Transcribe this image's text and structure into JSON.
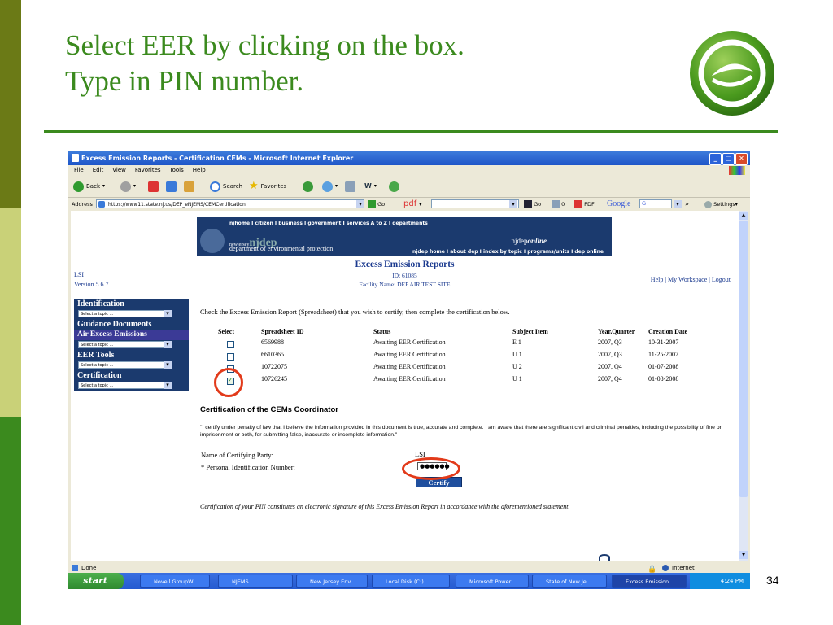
{
  "slide": {
    "title_line1": "Select EER by clicking on the box.",
    "title_line2": "Type in PIN number.",
    "page_number": "34",
    "colors": {
      "title": "#3b8a1e",
      "stripe_dark": "#6b7a16",
      "stripe_light": "#c9d178",
      "stripe_green": "#3b8a1e"
    }
  },
  "browser": {
    "title": "Excess Emission Reports - Certification CEMs - Microsoft Internet Explorer",
    "menu": [
      "File",
      "Edit",
      "View",
      "Favorites",
      "Tools",
      "Help"
    ],
    "toolbar": {
      "back": "Back",
      "search": "Search",
      "favorites": "Favorites",
      "go": "Go",
      "pdf": "pdf",
      "go2": "Go",
      "counter": "0",
      "pdf2": "PDF",
      "google": "Google",
      "g": "G",
      "settings": "Settings"
    },
    "address_label": "Address",
    "address": "https://www11.state.nj.us/DEP_eNJEMS/CEMCertification",
    "status": "Done",
    "zone": "Internet"
  },
  "taskbar": {
    "start": "start",
    "items": [
      "Novell GroupWi...",
      "NJEMS",
      "New Jersey Env...",
      "Local Disk (C:)",
      "Microsoft Power...",
      "State of New Je...",
      "Excess Emission..."
    ],
    "clock": "4:24 PM"
  },
  "page": {
    "banner": {
      "top_links": "njhome  I  citizen  I  business  I  government  I  services A to Z  I  departments",
      "newjersey": "newjersey",
      "njdep": "njdep",
      "dept": "department of environmental protection",
      "online_prefix": "njdep",
      "online": "online",
      "sub_links": "njdep home  I  about dep  I  index by topic  I  programs/units  I  dep online"
    },
    "report_title": "Excess Emission Reports",
    "id_line": "ID: 61085",
    "facility_line": "Facility Name: DEP AIR TEST SITE",
    "lsi": "LSI",
    "version": "Version 5.6.7",
    "links": {
      "help": "Help",
      "workspace": "My Workspace",
      "logout": "Logout",
      "sep": " | "
    },
    "sidebar": {
      "identification": "Identification",
      "guidance": "Guidance Documents",
      "air": "Air Excess Emissions",
      "eer_tools": "EER Tools",
      "certification": "Certification",
      "select_placeholder": "Select a topic ..."
    },
    "instruction": "Check the Excess Emission Report (Spreadsheet) that you wish to certify, then complete the certification below.",
    "table": {
      "headers": {
        "select": "Select",
        "id": "Spreadsheet ID",
        "status": "Status",
        "subject": "Subject Item",
        "yq": "Year,Quarter",
        "date": "Creation Date"
      },
      "rows": [
        {
          "id": "6569988",
          "status": "Awaiting EER Certification",
          "subject": "E 1",
          "yq": "2007, Q3",
          "date": "10-31-2007",
          "checked": false
        },
        {
          "id": "6610365",
          "status": "Awaiting EER Certification",
          "subject": "U 1",
          "yq": "2007, Q3",
          "date": "11-25-2007",
          "checked": false
        },
        {
          "id": "10722075",
          "status": "Awaiting EER Certification",
          "subject": "U 2",
          "yq": "2007, Q4",
          "date": "01-07-2008",
          "checked": false
        },
        {
          "id": "10726245",
          "status": "Awaiting EER Certification",
          "subject": "U 1",
          "yq": "2007, Q4",
          "date": "01-08-2008",
          "checked": true
        }
      ]
    },
    "cert_heading": "Certification of the CEMs Coordinator",
    "cert_statement": "\"I certify under penalty of law that I believe the information provided in this document is true, accurate and complete. I am aware that there are significant civil and criminal penalties, including the possibility of fine or imprisonment or both, for submitting false, inaccurate or incomplete information.\"",
    "name_label": "Name of Certifying Party:",
    "name_value": "LSI",
    "pin_label": "* Personal Identification Number:",
    "pin_value": "●●●●●●",
    "certify_button": "Certify",
    "footnote": "Certification of your PIN constitutes an electronic signature of this Excess Emission Report in accordance with the aforementioned statement."
  }
}
